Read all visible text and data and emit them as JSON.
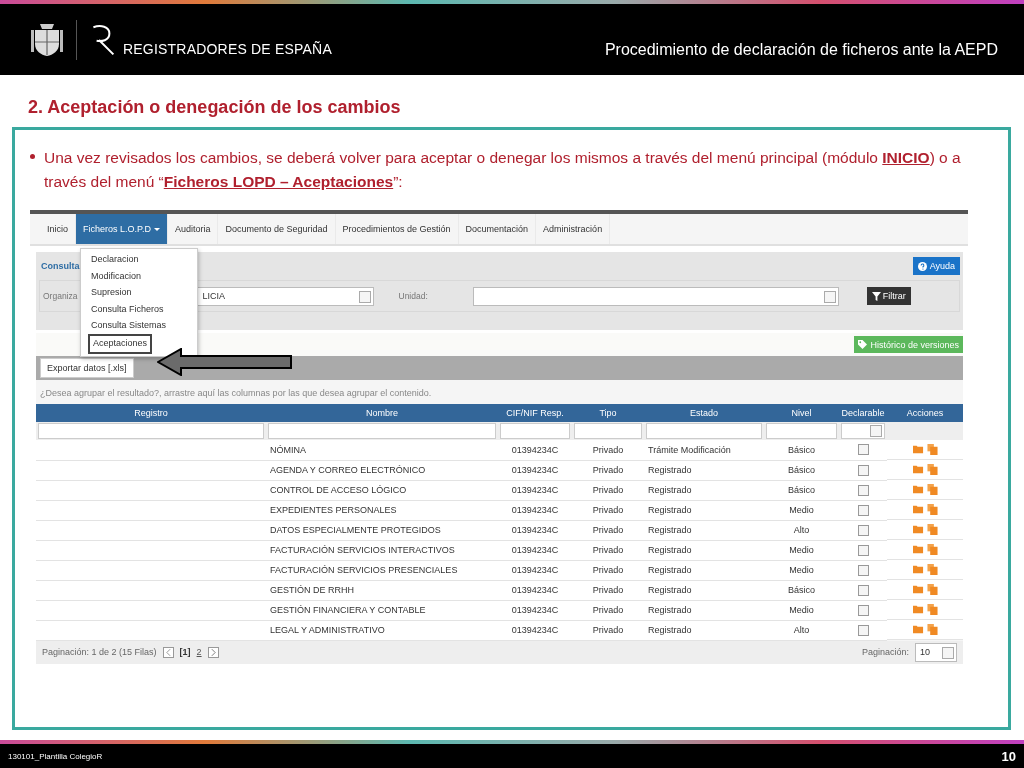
{
  "header": {
    "brand": "REGISTRADORES DE ESPAÑA",
    "title": "Procedimiento de declaración de ficheros ante la AEPD"
  },
  "heading": "2. Aceptación o denegación de los cambios",
  "bullet": "Una vez revisados los cambios, se deberá volver para aceptar o denegar los mismos a través  del menú principal (módulo **INICIO**)  o a través del menú “**Ficheros LOPD – Aceptaciones**”:",
  "app": {
    "nav": [
      {
        "label": "Inicio",
        "selected": false,
        "dropdown": false
      },
      {
        "label": "Ficheros L.O.P.D",
        "selected": true,
        "dropdown": true
      },
      {
        "label": "Auditoria",
        "selected": false,
        "dropdown": false
      },
      {
        "label": "Documento de Seguridad",
        "selected": false,
        "dropdown": false
      },
      {
        "label": "Procedimientos de Gestión",
        "selected": false,
        "dropdown": false
      },
      {
        "label": "Documentación",
        "selected": false,
        "dropdown": false
      },
      {
        "label": "Administración",
        "selected": false,
        "dropdown": false
      }
    ],
    "menu": [
      {
        "label": "Declaracion",
        "highlighted": false
      },
      {
        "label": "Modificacion",
        "highlighted": false
      },
      {
        "label": "Supresion",
        "highlighted": false
      },
      {
        "label": "Consulta Ficheros",
        "highlighted": false
      },
      {
        "label": "Consulta Sistemas",
        "highlighted": false
      },
      {
        "label": "Aceptaciones",
        "highlighted": true
      }
    ],
    "consulta": {
      "title": "Consulta",
      "help": "Ayuda",
      "org_label": "Organiza",
      "org_value": "LICIA",
      "unit_label": "Unidad:",
      "filter": "Filtrar"
    },
    "grid": {
      "history": "Histórico de versiones",
      "export": "Exportar datos [.xls]",
      "group_hint": "¿Desea agrupar el resultado?, arrastre aquí las columnas por las que desea agrupar el contenido.",
      "columns": [
        "Registro",
        "Nombre",
        "CIF/NIF Resp.",
        "Tipo",
        "Estado",
        "Nivel",
        "Declarable",
        "Acciones"
      ],
      "rows": [
        {
          "nombre": "NÓMINA",
          "cif": "01394234C",
          "tipo": "Privado",
          "estado": "Trámite Modificación",
          "nivel": "Básico",
          "declarable": false
        },
        {
          "nombre": "AGENDA Y CORREO ELECTRÓNICO",
          "cif": "01394234C",
          "tipo": "Privado",
          "estado": "Registrado",
          "nivel": "Básico",
          "declarable": false
        },
        {
          "nombre": "CONTROL DE ACCESO LÓGICO",
          "cif": "01394234C",
          "tipo": "Privado",
          "estado": "Registrado",
          "nivel": "Básico",
          "declarable": false
        },
        {
          "nombre": "EXPEDIENTES PERSONALES",
          "cif": "01394234C",
          "tipo": "Privado",
          "estado": "Registrado",
          "nivel": "Medio",
          "declarable": false
        },
        {
          "nombre": "DATOS ESPECIALMENTE PROTEGIDOS",
          "cif": "01394234C",
          "tipo": "Privado",
          "estado": "Registrado",
          "nivel": "Alto",
          "declarable": false
        },
        {
          "nombre": "FACTURACIÓN SERVICIOS INTERACTIVOS",
          "cif": "01394234C",
          "tipo": "Privado",
          "estado": "Registrado",
          "nivel": "Medio",
          "declarable": false
        },
        {
          "nombre": "FACTURACIÓN SERVICIOS PRESENCIALES",
          "cif": "01394234C",
          "tipo": "Privado",
          "estado": "Registrado",
          "nivel": "Medio",
          "declarable": false
        },
        {
          "nombre": "GESTIÓN DE RRHH",
          "cif": "01394234C",
          "tipo": "Privado",
          "estado": "Registrado",
          "nivel": "Básico",
          "declarable": false
        },
        {
          "nombre": "GESTIÓN FINANCIERA Y CONTABLE",
          "cif": "01394234C",
          "tipo": "Privado",
          "estado": "Registrado",
          "nivel": "Medio",
          "declarable": false
        },
        {
          "nombre": "LEGAL Y ADMINISTRATIVO",
          "cif": "01394234C",
          "tipo": "Privado",
          "estado": "Registrado",
          "nivel": "Alto",
          "declarable": false
        }
      ],
      "pager": {
        "info": "Paginación: 1 de 2 (15 Filas)",
        "pages": [
          {
            "label": "[1]",
            "selected": true
          },
          {
            "label": "2",
            "selected": false
          }
        ],
        "size_label": "Paginación:",
        "size": "10"
      }
    }
  },
  "footer": {
    "template": "130101_Plantilla ColegioR",
    "page": "10"
  }
}
